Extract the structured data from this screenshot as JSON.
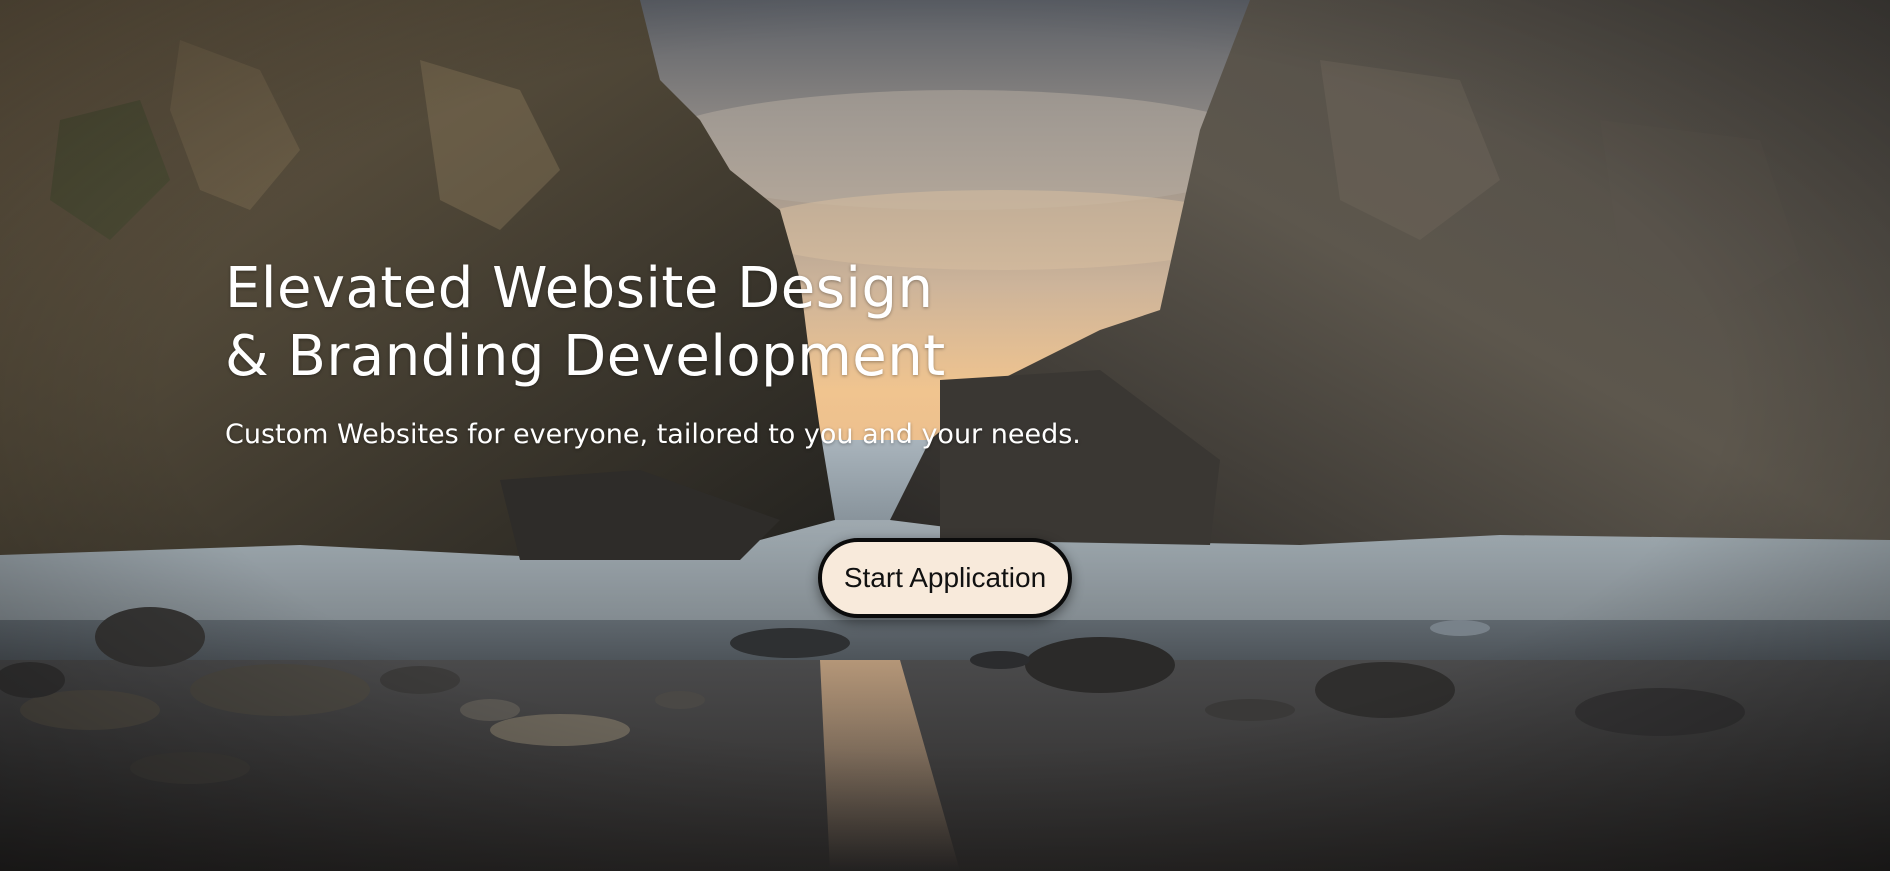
{
  "hero": {
    "headline_line1": "Elevated Website Design",
    "headline_line2": "& Branding Development",
    "subtitle": "Custom Websites for everyone, tailored to you and your needs.",
    "cta_label": "Start Application"
  },
  "colors": {
    "text": "#ffffff",
    "button_background": "#f8eadb",
    "button_border": "#0b0b0b",
    "button_text": "#111111"
  }
}
